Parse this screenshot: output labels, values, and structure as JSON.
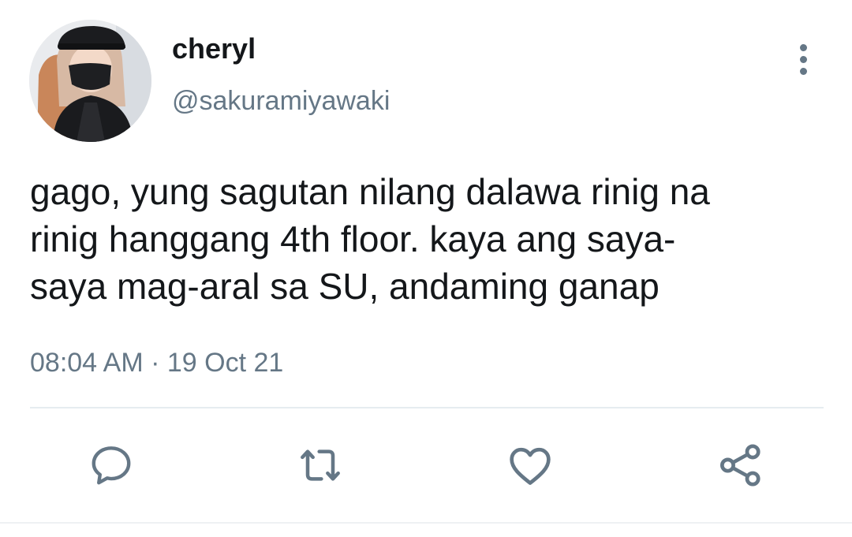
{
  "tweet": {
    "display_name": "cheryl",
    "handle": "@sakuramiyawaki",
    "text_lines": [
      "gago, yung sagutan nilang dalawa rinig na",
      "rinig hanggang 4th floor. kaya ang saya-",
      "saya mag-aral sa SU, andaming ganap"
    ],
    "time": "08:04 AM",
    "separator": "·",
    "date": "19 Oct 21"
  },
  "actions": [
    {
      "icon": "reply-icon"
    },
    {
      "icon": "retweet-icon"
    },
    {
      "icon": "like-icon"
    },
    {
      "icon": "share-icon"
    }
  ],
  "colors": {
    "text": "#14171a",
    "secondary": "#657786",
    "divider": "#e6ecf0"
  }
}
